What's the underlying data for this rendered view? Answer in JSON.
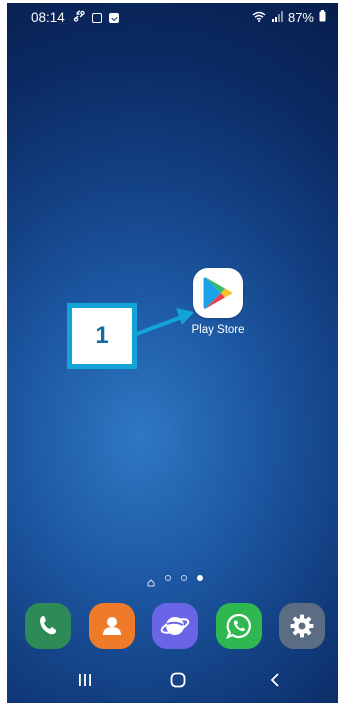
{
  "status_bar": {
    "time": "08:14",
    "battery": "87%",
    "icons_left": [
      "link-icon",
      "picture-icon",
      "checkbox-icon"
    ],
    "icons_right": [
      "wifi-icon",
      "signal-icon",
      "battery-icon"
    ]
  },
  "home": {
    "apps": [
      {
        "label": "Play Store",
        "icon": "play-store-icon"
      }
    ],
    "callout": {
      "number": "1"
    },
    "page_indicator": {
      "pages": 4,
      "active_page": 4
    }
  },
  "dock": {
    "apps": [
      {
        "icon": "phone-icon",
        "color": "#2e8b57"
      },
      {
        "icon": "contacts-icon",
        "color": "#ef7a2a"
      },
      {
        "icon": "internet-icon",
        "color": "#6a64e6"
      },
      {
        "icon": "whatsapp-icon",
        "color": "#2fb84f"
      },
      {
        "icon": "settings-icon",
        "color": "#5b6d82"
      }
    ]
  },
  "nav_bar": {
    "buttons": [
      "recents-icon",
      "home-icon",
      "back-icon"
    ]
  },
  "colors": {
    "callout_border": "#12a3d8",
    "callout_text": "#0f6fa2",
    "wallpaper_dark": "#081f4e",
    "wallpaper_light": "#2f78c2"
  }
}
